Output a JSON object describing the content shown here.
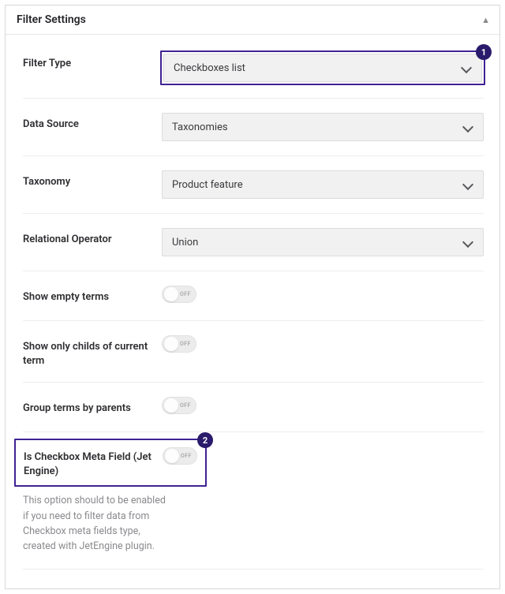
{
  "panel": {
    "title": "Filter Settings"
  },
  "annotations": {
    "badge1": "1",
    "badge2": "2"
  },
  "toggle": {
    "off_label": "OFF"
  },
  "rows": {
    "filter_type": {
      "label": "Filter Type",
      "value": "Checkboxes list"
    },
    "data_source": {
      "label": "Data Source",
      "value": "Taxonomies"
    },
    "taxonomy": {
      "label": "Taxonomy",
      "value": "Product feature"
    },
    "relational_operator": {
      "label": "Relational Operator",
      "value": "Union"
    },
    "show_empty": {
      "label": "Show empty terms"
    },
    "show_childs": {
      "label": "Show only childs of current term"
    },
    "group_by_parents": {
      "label": "Group terms by parents"
    },
    "is_checkbox_meta": {
      "label": "Is Checkbox Meta Field (Jet Engine)",
      "help": "This option should to be enabled if you need to filter data from Checkbox meta fields type, created with JetEngine plugin."
    }
  }
}
